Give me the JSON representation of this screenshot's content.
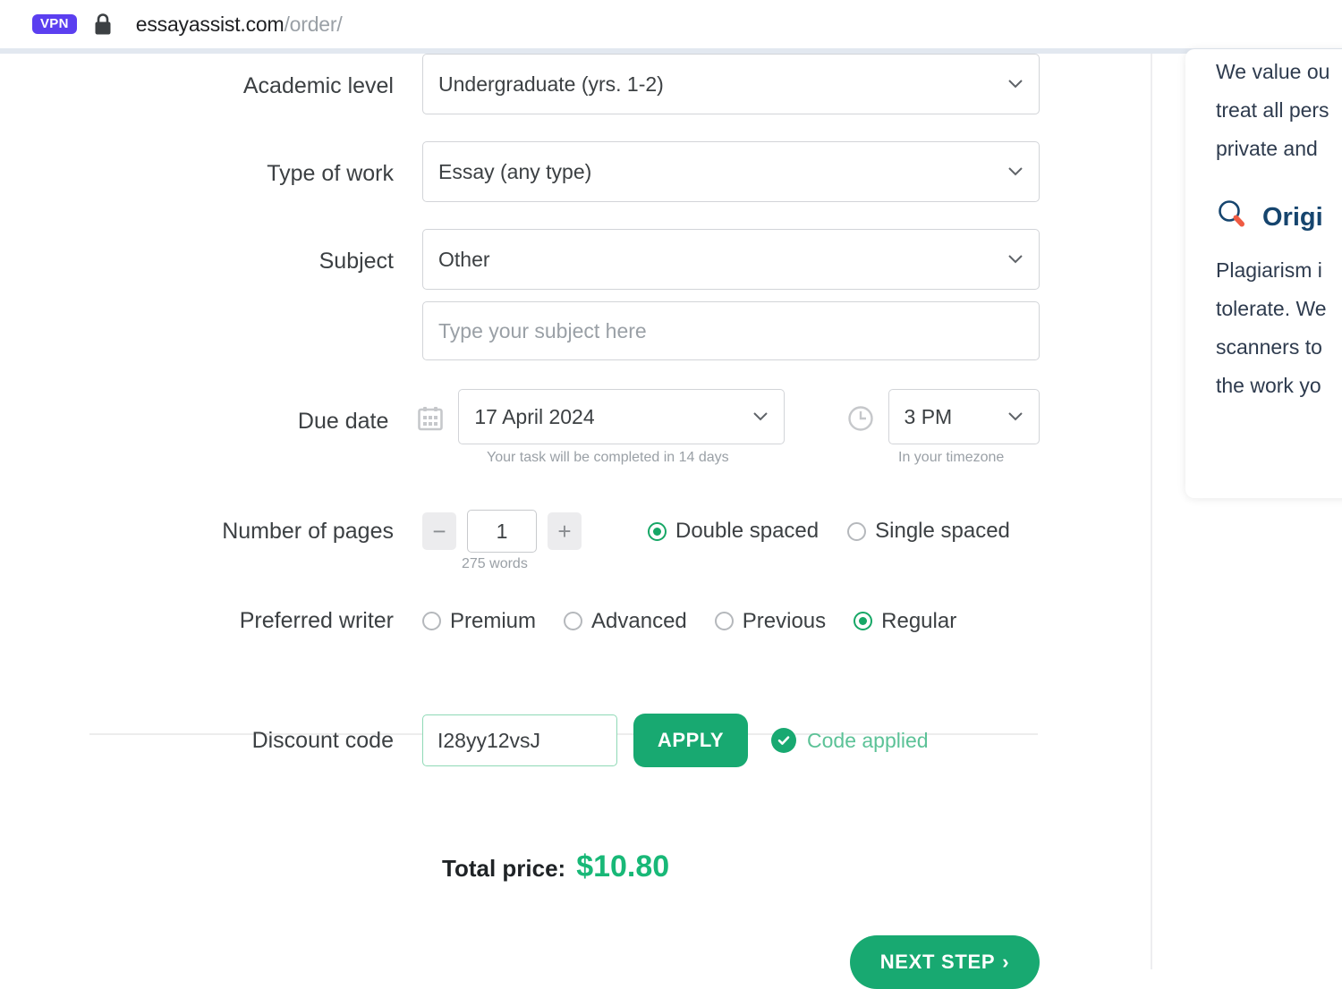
{
  "browser": {
    "vpn_badge": "VPN",
    "lock_icon": "lock-icon",
    "url_domain": "essayassist.com",
    "url_path": "/order/"
  },
  "form": {
    "academic_level": {
      "label": "Academic level",
      "value": "Undergraduate (yrs. 1-2)"
    },
    "type_of_work": {
      "label": "Type of work",
      "value": "Essay (any type)"
    },
    "subject": {
      "label": "Subject",
      "value": "Other",
      "custom_placeholder": "Type your subject here",
      "custom_value": ""
    },
    "due_date": {
      "label": "Due date",
      "date_value": "17 April 2024",
      "date_hint": "Your task will be completed in 14 days",
      "time_value": "3 PM",
      "time_hint": "In your timezone",
      "calendar_icon": "calendar-icon",
      "clock_icon": "clock-icon"
    },
    "pages": {
      "label": "Number of pages",
      "decrement": "−",
      "value": "1",
      "increment": "+",
      "words_hint": "275 words",
      "spacing_options": [
        {
          "label": "Double spaced",
          "selected": true
        },
        {
          "label": "Single spaced",
          "selected": false
        }
      ]
    },
    "preferred_writer": {
      "label": "Preferred writer",
      "options": [
        {
          "label": "Premium",
          "selected": false
        },
        {
          "label": "Advanced",
          "selected": false
        },
        {
          "label": "Previous",
          "selected": false
        },
        {
          "label": "Regular",
          "selected": true
        }
      ]
    },
    "discount": {
      "label": "Discount code",
      "value": "I28yy12vsJ",
      "placeholder": "",
      "apply_label": "APPLY",
      "status_text": "Code applied",
      "status_icon": "check-circle-icon"
    },
    "total": {
      "label": "Total price:",
      "value": "$10.80"
    },
    "next_step": {
      "label": "NEXT STEP",
      "chevron": "›"
    }
  },
  "sidebar": {
    "privacy_lines": [
      "We value ou",
      "treat all pers",
      "private and"
    ],
    "originality_heading": "Origi",
    "originality_icon": "magnifier-pencil-icon",
    "originality_lines": [
      "Plagiarism i",
      "tolerate. We",
      "scanners to",
      "the work yo"
    ]
  },
  "colors": {
    "accent_green": "#18a971",
    "price_green": "#18b877",
    "vpn_purple": "#5b3ff0",
    "heading_blue": "#16456e",
    "muted": "#9aa0a6"
  }
}
